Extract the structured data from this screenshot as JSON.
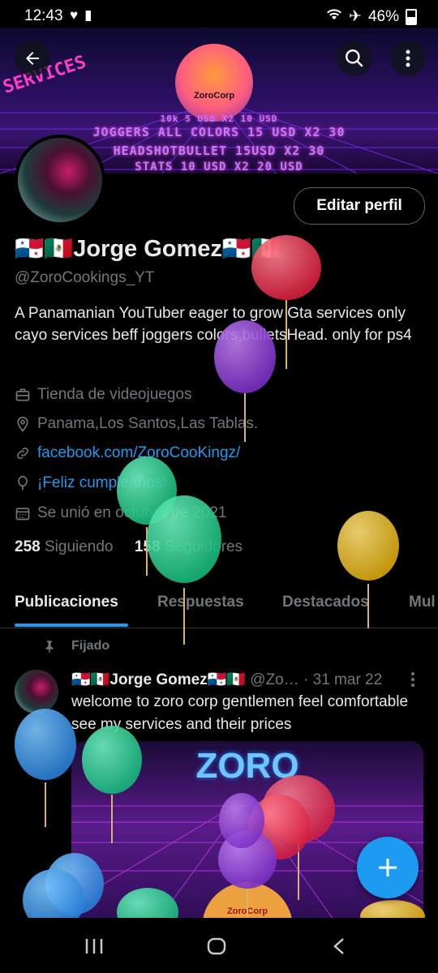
{
  "status_bar": {
    "time": "12:43",
    "battery": "46%"
  },
  "banner": {
    "logo_text": "ZoroCorp",
    "tag_text": "SERVICES",
    "promo_lines": [
      "10k 5 USD X2 10 USD",
      "JOGGERS ALL COLORS 15 USD X2 30",
      "HEADSHOTBULLET 15USD X2 30",
      "STATS 10 USD X2 20 USD"
    ]
  },
  "profile": {
    "edit_button": "Editar perfil",
    "name": "🇵🇦🇲🇽Jorge Gomez🇵🇦🇲🇽",
    "handle": "@ZoroCookings_YT",
    "bio": "A Panamanian YouTuber eager to grow Gta services only cayo services beff joggers colors,bulletsHead. only for ps4",
    "category": "Tienda de videojuegos",
    "location": "Panama,Los Santos,Las Tablas.",
    "website": "facebook.com/ZoroCooKingz/",
    "birthday": "¡Feliz cumpleaños!",
    "joined": "Se unió en octubre de 2021",
    "following_count": "258",
    "following_label": "Siguiendo",
    "followers_count": "158",
    "followers_label": "Seguidores"
  },
  "tabs": [
    "Publicaciones",
    "Respuestas",
    "Destacados",
    "Mul"
  ],
  "pinned_label": "Fijado",
  "post": {
    "author": "🇵🇦🇲🇽Jorge Gomez🇵🇦🇲🇽",
    "handle": "@Zo…",
    "date": "· 31 mar 22",
    "text": "welcome to zoro corp gentlemen feel comfortable see my services and their prices",
    "image_title": "ZORO",
    "image_logo": "ZoroCorp"
  },
  "colors": {
    "accent": "#1d9bf0",
    "muted": "#71767b",
    "text": "#e7e9ea",
    "border": "#2f3336"
  }
}
